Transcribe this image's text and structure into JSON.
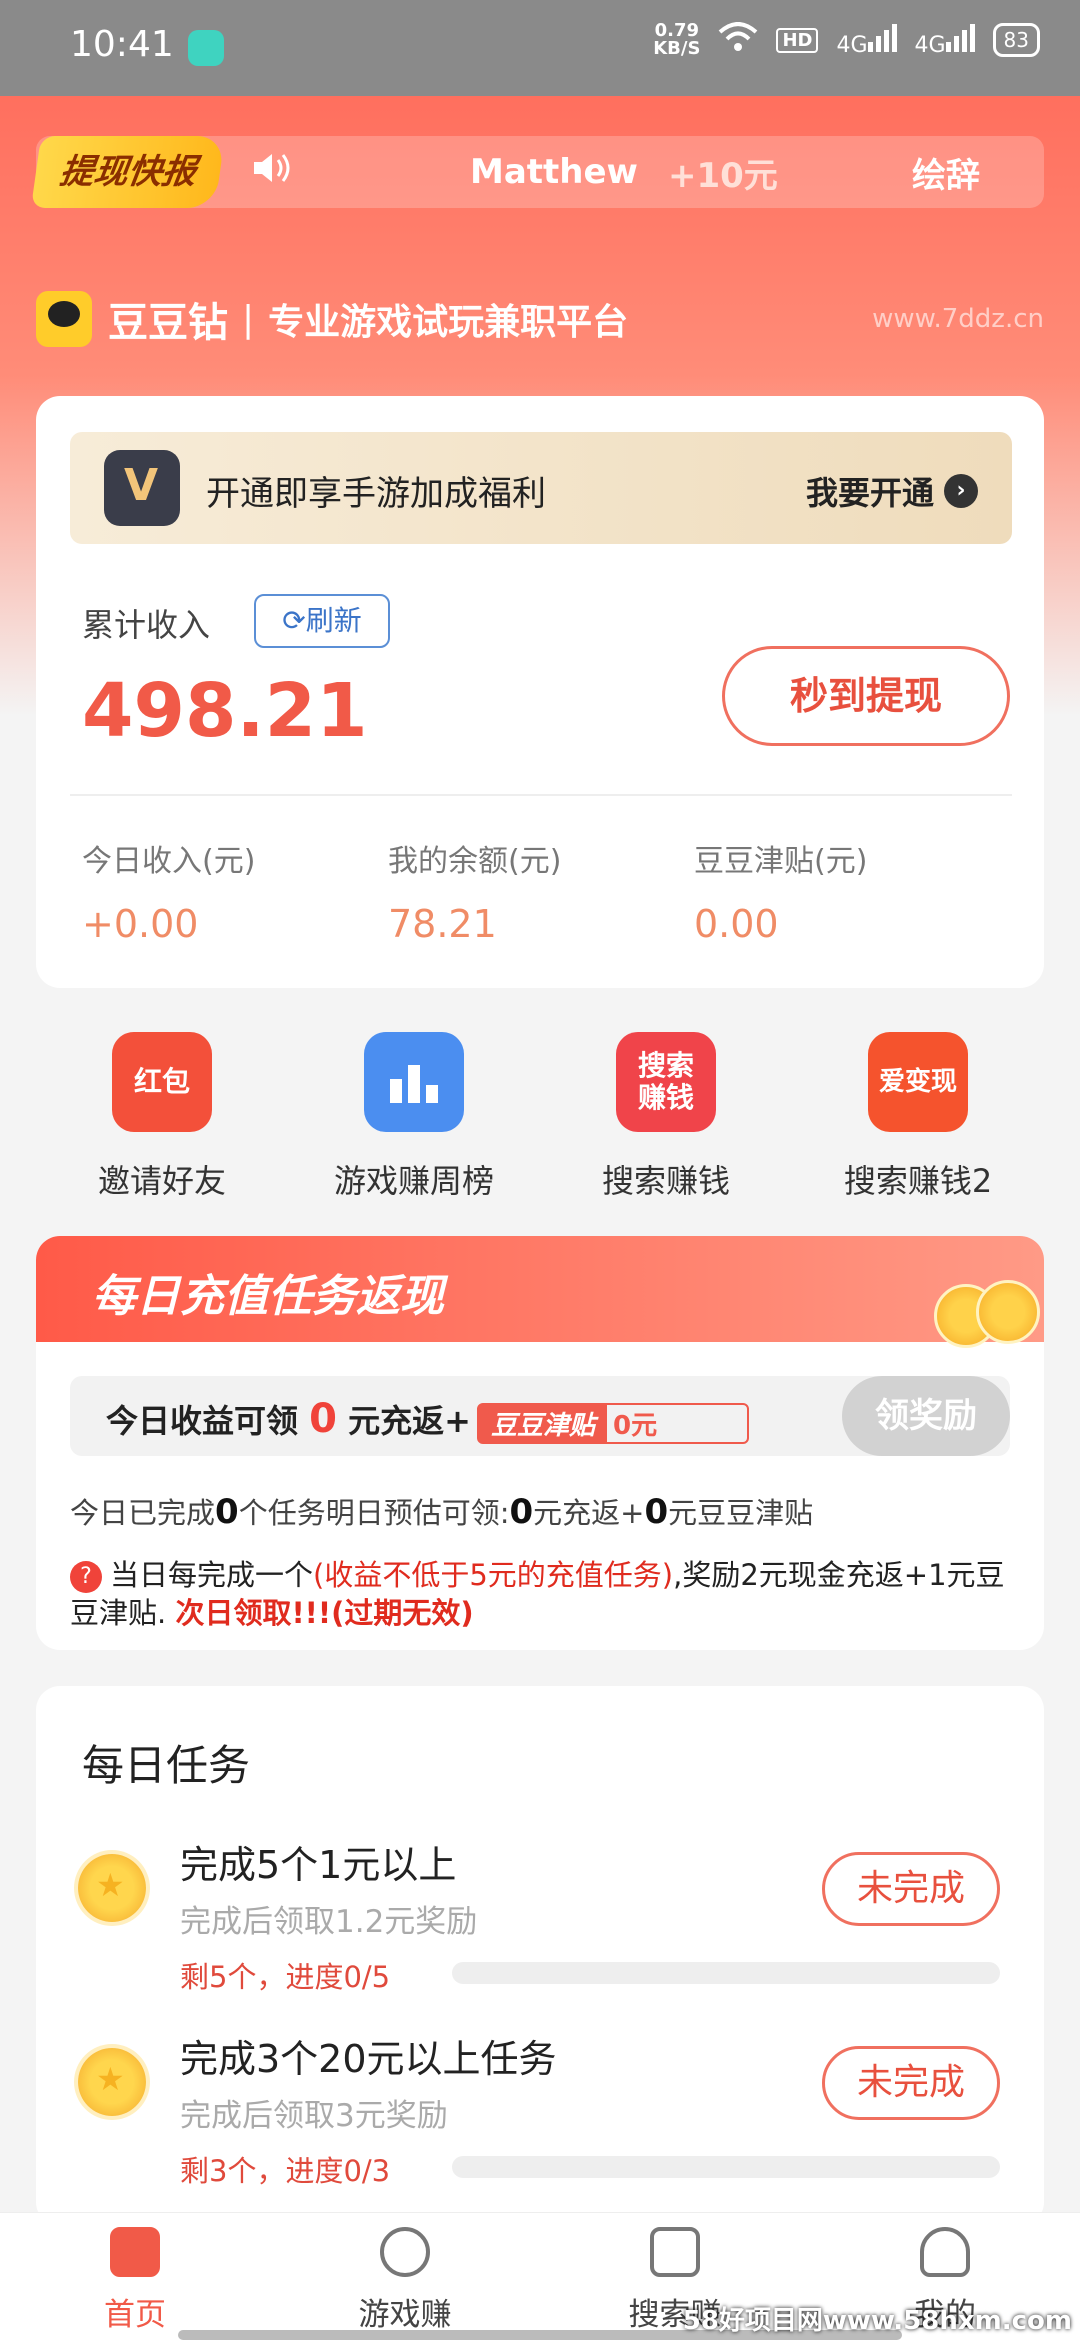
{
  "status_bar": {
    "time": "10:41",
    "net_speed_value": "0.79",
    "net_speed_unit": "KB/S",
    "hd": "HD",
    "sig1": "4G",
    "sig2": "4G",
    "battery": "83"
  },
  "ticker": {
    "tag": "提现快报",
    "name": "Matthew",
    "amount": "+10元",
    "nick": "绘辞"
  },
  "brand": {
    "name": "豆豆钻",
    "slogan": "专业游戏试玩兼职平台",
    "site": "www.7ddz.cn"
  },
  "vip": {
    "text": "开通即享手游加成福利",
    "cta": "我要开通"
  },
  "income": {
    "total_label": "累计收入",
    "refresh": "刷新",
    "total_value": "498.21",
    "withdraw": "秒到提现",
    "stats": [
      {
        "label": "今日收入(元)",
        "value": "+0.00"
      },
      {
        "label": "我的余额(元)",
        "value": "78.21"
      },
      {
        "label": "豆豆津贴(元)",
        "value": "0.00"
      }
    ]
  },
  "shortcuts": [
    {
      "label": "邀请好友",
      "icon": "红包",
      "color": "#f3503a"
    },
    {
      "label": "游戏赚周榜",
      "icon": "",
      "color": "#4b8ef0"
    },
    {
      "label": "搜索赚钱",
      "icon": "搜索\n赚钱",
      "color": "#f0444a"
    },
    {
      "label": "搜索赚钱2",
      "icon": "爱变现",
      "color": "#f5532d"
    }
  ],
  "recharge": {
    "title": "每日充值任务返现",
    "claim_prefix": "今日收益可领",
    "claim_zero": "0",
    "claim_suffix": "元充返+",
    "pill_tag": "豆豆津贴",
    "pill_val": "0元",
    "claim_button": "领奖励",
    "predict_1": "今日已完成",
    "predict_n1": "0",
    "predict_2": "个任务明日预估可领:",
    "predict_n2": "0",
    "predict_3": "元充返+",
    "predict_n3": "0",
    "predict_4": "元豆豆津贴",
    "rule_q": "?",
    "rule_1": "当日每完成一个",
    "rule_red": "(收益不低于5元的充值任务)",
    "rule_2": ",奖励2元现金充返+1元豆豆津贴.",
    "rule_strong": "次日领取!!!(过期无效)"
  },
  "daily": {
    "title": "每日任务",
    "tasks": [
      {
        "name": "完成5个1元以上",
        "sub": "完成后领取1.2元奖励",
        "progress": "剩5个，进度0/5",
        "status": "未完成",
        "fraction": 0
      },
      {
        "name": "完成3个20元以上任务",
        "sub": "完成后领取3元奖励",
        "progress": "剩3个，进度0/3",
        "status": "未完成",
        "fraction": 0
      }
    ]
  },
  "tabbar": [
    {
      "label": "首页",
      "active": true
    },
    {
      "label": "游戏赚",
      "active": false
    },
    {
      "label": "搜索赚",
      "active": false
    },
    {
      "label": "我的",
      "active": false
    }
  ],
  "watermark": "58好项目网www.58hxm.com"
}
